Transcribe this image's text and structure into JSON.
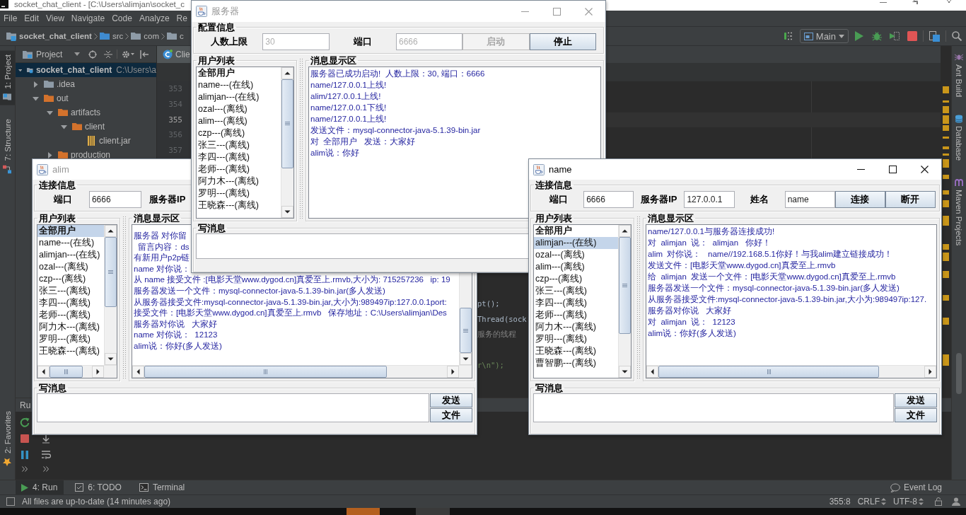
{
  "ide": {
    "title": "socket_chat_client - [C:\\Users\\alimjan\\socket_c",
    "menu": [
      "File",
      "Edit",
      "View",
      "Navigate",
      "Code",
      "Analyze",
      "Re"
    ],
    "breadcrumbs": [
      {
        "label": "socket_chat_client",
        "kind": "module"
      },
      {
        "label": "src",
        "kind": "source_folder"
      },
      {
        "label": "com",
        "kind": "folder"
      },
      {
        "label": "c",
        "kind": "folder"
      }
    ],
    "run_configuration": "Main",
    "left_tools": [
      {
        "label": "1: Project",
        "kind": "project",
        "selected": true
      },
      {
        "label": "7: Structure",
        "kind": "structure",
        "selected": false
      }
    ],
    "left_tools_bottom": [
      {
        "label": "2: Favorites",
        "kind": "favorites",
        "selected": false
      }
    ],
    "right_tools": [
      {
        "label": "Ant Build",
        "kind": "ant"
      },
      {
        "label": "Database",
        "kind": "database"
      },
      {
        "label": "Maven Projects",
        "kind": "maven"
      }
    ],
    "project_panel": {
      "title": "Project",
      "tree": [
        {
          "label": "socket_chat_client",
          "path": "C:\\Users\\a",
          "kind": "module",
          "expanded": true,
          "selected": true,
          "children": [
            {
              "label": ".idea",
              "kind": "folder",
              "expanded": false,
              "selected": false
            },
            {
              "label": "out",
              "kind": "excluded_folder",
              "expanded": true,
              "selected": false,
              "children": [
                {
                  "label": "artifacts",
                  "kind": "excluded_folder",
                  "expanded": true,
                  "selected": false,
                  "children": [
                    {
                      "label": "client",
                      "kind": "excluded_folder",
                      "expanded": true,
                      "selected": false,
                      "children": [
                        {
                          "label": "client.jar",
                          "kind": "jar",
                          "selected": false
                        }
                      ]
                    }
                  ]
                },
                {
                  "label": "production",
                  "kind": "excluded_folder",
                  "expanded": false,
                  "selected": false
                }
              ]
            }
          ]
        }
      ]
    },
    "editor": {
      "tab": "Clie",
      "line_numbers": [
        {
          "number": "353",
          "current": false
        },
        {
          "number": "354",
          "current": false
        },
        {
          "number": "355",
          "current": true
        },
        {
          "number": "356",
          "current": false
        },
        {
          "number": "357",
          "current": false
        }
      ],
      "code_lines": [
        {
          "text": "pt();",
          "kind": "code"
        },
        {
          "text": "Thread(sock",
          "kind": "code"
        },
        {
          "text": "服务的线程",
          "kind": "comment"
        },
        {
          "kind": "blank"
        },
        {
          "text": "r\\n\");",
          "kind": "string"
        }
      ]
    },
    "run_panel": {
      "title": "Ru"
    },
    "tool_tabs": [
      {
        "label": "4: Run",
        "kind": "run",
        "selected": true
      },
      {
        "label": "6: TODO",
        "kind": "todo",
        "selected": false
      },
      {
        "label": "Terminal",
        "kind": "terminal",
        "selected": false
      }
    ],
    "event_log": "Event Log",
    "status_bar": {
      "message": "All files are up-to-date (14 minutes ago)",
      "caret_position": "355:8",
      "line_separator": "CRLF",
      "encoding": "UTF-8"
    }
  },
  "windows": [
    {
      "kind": "server",
      "title": "服务器",
      "active": false,
      "config": {
        "title": "配置信息",
        "items": [
          {
            "kind": "label",
            "text": "人数上限"
          },
          {
            "kind": "field",
            "value": "30",
            "disabled": true
          },
          {
            "kind": "label",
            "text": "端口"
          },
          {
            "kind": "field",
            "value": "6666",
            "disabled": true
          },
          {
            "kind": "button",
            "text": "启动",
            "disabled": true
          },
          {
            "kind": "button",
            "text": "停止",
            "disabled": false
          }
        ]
      },
      "users": {
        "title": "用户列表",
        "vertical_scrollbar": true,
        "items": [
          {
            "label": "全部用户",
            "kind": "group",
            "selected": false
          },
          {
            "label": "name---(在线)",
            "kind": "user",
            "selected": false
          },
          {
            "label": "alimjan---(在线)",
            "kind": "user",
            "selected": false
          },
          {
            "label": "ozal---(离线)",
            "kind": "user",
            "selected": false
          },
          {
            "label": "alim---(离线)",
            "kind": "user",
            "selected": false
          },
          {
            "label": "czp---(离线)",
            "kind": "user",
            "selected": false
          },
          {
            "label": "张三---(离线)",
            "kind": "user",
            "selected": false
          },
          {
            "label": "李四---(离线)",
            "kind": "user",
            "selected": false
          },
          {
            "label": "老师---(离线)",
            "kind": "user",
            "selected": false
          },
          {
            "label": "阿力木---(离线)",
            "kind": "user",
            "selected": false
          },
          {
            "label": "罗明---(离线)",
            "kind": "user",
            "selected": false
          },
          {
            "label": "王晓森---(离线)",
            "kind": "user",
            "selected": false
          }
        ]
      },
      "messages": {
        "title": "消息显示区",
        "lines": [
          "服务器已成功启动!  人数上限：30, 端口：6666",
          "name/127.0.0.1上线!",
          "alim/127.0.0.1上线!",
          "name/127.0.0.1下线!",
          "name/127.0.0.1上线!",
          "发送文件：mysql-connector-java-5.1.39-bin.jar",
          "对  全部用户   发送：大家好",
          "alim说：你好"
        ]
      },
      "compose": {
        "title": "写消息"
      }
    },
    {
      "kind": "client",
      "title": "alim",
      "active": false,
      "config": {
        "title": "连接信息",
        "items": [
          {
            "kind": "label",
            "text": "端口"
          },
          {
            "kind": "field",
            "value": "6666",
            "disabled": false
          },
          {
            "kind": "label",
            "text": "服务器IP"
          }
        ]
      },
      "users": {
        "title": "用户列表",
        "vertical_scrollbar": true,
        "horizontal_scrollbar": true,
        "items": [
          {
            "label": "全部用户",
            "kind": "group",
            "selected": true
          },
          {
            "label": "name---(在线)",
            "kind": "user",
            "selected": false
          },
          {
            "label": "alimjan---(在线)",
            "kind": "user",
            "selected": false
          },
          {
            "label": "ozal---(离线)",
            "kind": "user",
            "selected": false
          },
          {
            "label": "czp---(离线)",
            "kind": "user",
            "selected": false
          },
          {
            "label": "张三---(离线)",
            "kind": "user",
            "selected": false
          },
          {
            "label": "李四---(离线)",
            "kind": "user",
            "selected": false
          },
          {
            "label": "老师---(离线)",
            "kind": "user",
            "selected": false
          },
          {
            "label": "阿力木---(离线)",
            "kind": "user",
            "selected": false
          },
          {
            "label": "罗明---(离线)",
            "kind": "user",
            "selected": false
          },
          {
            "label": "王晓森---(离线)",
            "kind": "user",
            "selected": false
          }
        ]
      },
      "messages": {
        "title": "消息显示区",
        "vertical_scrollbar": true,
        "horizontal_scrollbar": true,
        "lines": [
          "服务器 对你留",
          "  留言内容：ds",
          "有新用户p2p链",
          "name 对你说：",
          "从 name 接受文件 :[电影天堂www.dygod.cn]真爱至上.rmvb,大小为: 715257236   ip: 19",
          "服务器发送一个文件：mysql-connector-java-5.1.39-bin.jar(多人发送)",
          "从服务器接受文件:mysql-connector-java-5.1.39-bin.jar,大小为:989497ip:127.0.0.1port:",
          "接受文件：[电影天堂www.dygod.cn]真爱至上.rmvb   保存地址：C:\\Users\\alimjan\\Des",
          "服务器对你说   大家好",
          "name 对你说：  12123",
          "alim说：你好(多人发送)"
        ]
      },
      "compose": {
        "title": "写消息",
        "buttons": [
          "发送",
          "文件"
        ]
      }
    },
    {
      "kind": "client",
      "title": "name",
      "active": true,
      "config": {
        "title": "连接信息",
        "items": [
          {
            "kind": "label",
            "text": "端口"
          },
          {
            "kind": "field",
            "value": "6666",
            "disabled": false
          },
          {
            "kind": "label",
            "text": "服务器IP"
          },
          {
            "kind": "field",
            "value": "127.0.0.1",
            "disabled": false
          },
          {
            "kind": "label",
            "text": "姓名"
          },
          {
            "kind": "field",
            "value": "name",
            "disabled": false
          },
          {
            "kind": "button",
            "text": "连接",
            "disabled": false
          },
          {
            "kind": "button",
            "text": "断开",
            "disabled": false
          }
        ]
      },
      "users": {
        "title": "用户列表",
        "vertical_scrollbar": true,
        "items": [
          {
            "label": "全部用户",
            "kind": "group",
            "selected": false
          },
          {
            "label": "alimjan---(在线)",
            "kind": "user",
            "selected": true
          },
          {
            "label": "ozal---(离线)",
            "kind": "user",
            "selected": false
          },
          {
            "label": "alim---(离线)",
            "kind": "user",
            "selected": false
          },
          {
            "label": "czp---(离线)",
            "kind": "user",
            "selected": false
          },
          {
            "label": "张三---(离线)",
            "kind": "user",
            "selected": false
          },
          {
            "label": "李四---(离线)",
            "kind": "user",
            "selected": false
          },
          {
            "label": "老师---(离线)",
            "kind": "user",
            "selected": false
          },
          {
            "label": "阿力木---(离线)",
            "kind": "user",
            "selected": false
          },
          {
            "label": "罗明---(离线)",
            "kind": "user",
            "selected": false
          },
          {
            "label": "王晓森---(离线)",
            "kind": "user",
            "selected": false
          },
          {
            "label": "曹智鹏---(离线)",
            "kind": "user",
            "selected": false
          }
        ]
      },
      "messages": {
        "title": "消息显示区",
        "horizontal_scrollbar": true,
        "lines": [
          "name/127.0.0.1与服务器连接成功!",
          "对  alimjan  说：  alimjan   你好！",
          "alim  对你说：   name//192.168.5.1你好！与我alim建立链接成功！",
          "发送文件：[电影天堂www.dygod.cn]真爱至上.rmvb",
          "给  alimjan  发送一个文件：[电影天堂www.dygod.cn]真爱至上.rmvb",
          "服务器发送一个文件：mysql-connector-java-5.1.39-bin.jar(多人发送)",
          "从服务器接受文件:mysql-connector-java-5.1.39-bin.jar,大小为:989497ip:127.",
          "服务器对你说   大家好",
          "对  alimjan  说：  12123",
          "alim说：你好(多人发送)"
        ]
      },
      "compose": {
        "title": "写消息",
        "buttons": [
          "发送",
          "文件"
        ]
      }
    }
  ]
}
